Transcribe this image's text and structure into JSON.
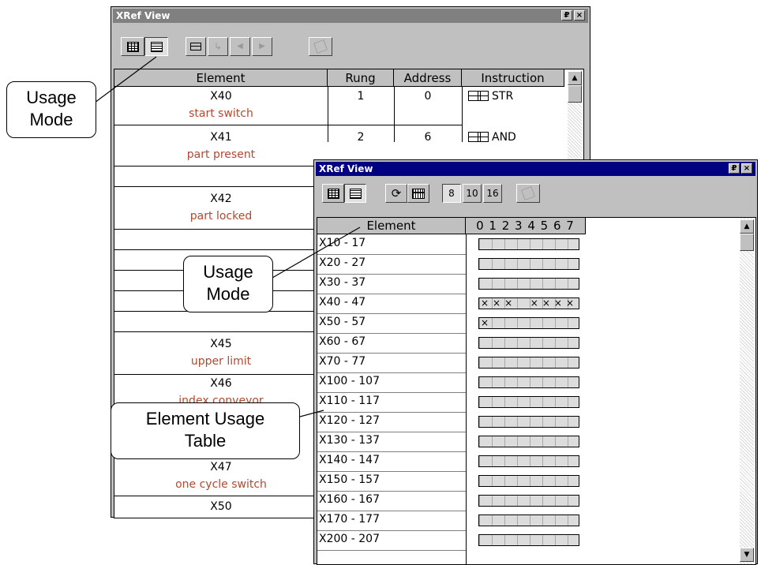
{
  "window1": {
    "title": "XRef View",
    "pin_glyph": "₽",
    "close_glyph": "×",
    "columns": [
      "Element",
      "Rung",
      "Address",
      "Instruction"
    ],
    "rows": [
      {
        "element": "X40",
        "desc": "start switch",
        "rung": "1",
        "address": "0",
        "instruction": "STR"
      },
      {
        "element": "X41",
        "desc": "part present",
        "rung": "2",
        "address": "6",
        "instruction": "AND"
      },
      {
        "element": "X42",
        "desc": "part locked"
      },
      {
        "element": "X45",
        "desc": "upper limit"
      },
      {
        "element": "X46",
        "desc": "index conveyor"
      },
      {
        "element": "X47",
        "desc": "one cycle switch"
      },
      {
        "element": "X50",
        "desc": ""
      }
    ]
  },
  "window2": {
    "title": "XRef View",
    "pin_glyph": "₽",
    "close_glyph": "×",
    "base_buttons": [
      "8",
      "10",
      "16"
    ],
    "columns": [
      "Element",
      "0 1 2 3 4 5 6 7"
    ],
    "rows": [
      {
        "range": "X10 - 17",
        "marks": ""
      },
      {
        "range": "X20 - 27",
        "marks": ""
      },
      {
        "range": "X30 - 37",
        "marks": ""
      },
      {
        "range": "X40 - 47",
        "marks": "×××  ××××"
      },
      {
        "range": "X50 - 57",
        "marks": "×"
      },
      {
        "range": "X60 - 67",
        "marks": ""
      },
      {
        "range": "X70 - 77",
        "marks": ""
      },
      {
        "range": "X100 - 107",
        "marks": ""
      },
      {
        "range": "X110 - 117",
        "marks": ""
      },
      {
        "range": "X120 - 127",
        "marks": ""
      },
      {
        "range": "X130 - 137",
        "marks": ""
      },
      {
        "range": "X140 - 147",
        "marks": ""
      },
      {
        "range": "X150 - 157",
        "marks": ""
      },
      {
        "range": "X160 - 167",
        "marks": ""
      },
      {
        "range": "X170 - 177",
        "marks": ""
      },
      {
        "range": "X200 - 207",
        "marks": ""
      }
    ]
  },
  "callouts": {
    "usage_mode_1": [
      "Usage",
      "Mode"
    ],
    "usage_mode_2": [
      "Usage",
      "Mode"
    ],
    "element_usage_table": [
      "Element Usage",
      "Table"
    ]
  },
  "icons": {
    "scroll_up": "▲",
    "scroll_down": "▼",
    "arrow_left": "◀",
    "arrow_right": "▶"
  }
}
